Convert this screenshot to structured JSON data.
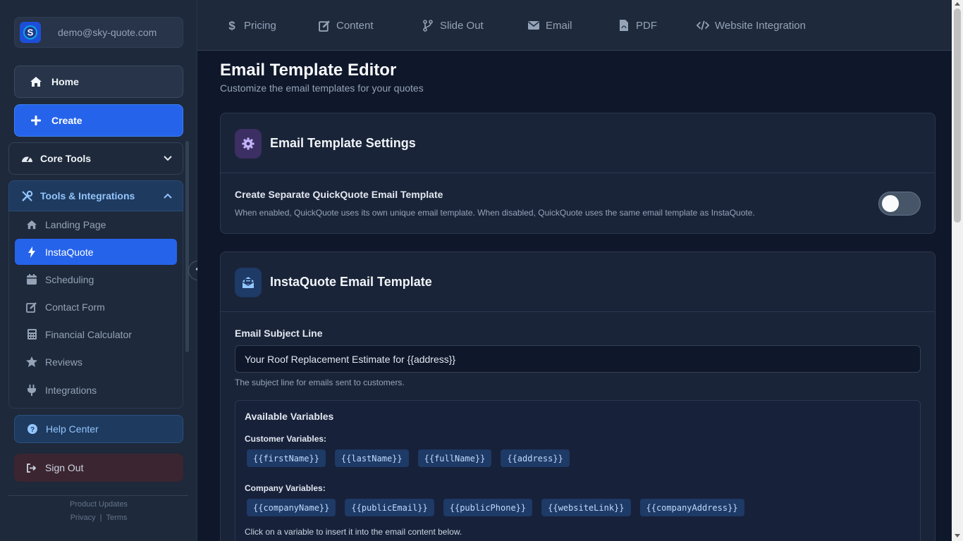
{
  "account": {
    "email": "demo@sky-quote.com"
  },
  "sidebar": {
    "home_label": "Home",
    "create_label": "Create",
    "core_tools_label": "Core Tools",
    "tools_integrations_label": "Tools & Integrations",
    "items": [
      {
        "label": "Landing Page",
        "icon": "house-icon"
      },
      {
        "label": "InstaQuote",
        "icon": "bolt-icon"
      },
      {
        "label": "Scheduling",
        "icon": "calendar-icon"
      },
      {
        "label": "Contact Form",
        "icon": "edit-icon"
      },
      {
        "label": "Financial Calculator",
        "icon": "calculator-icon"
      },
      {
        "label": "Reviews",
        "icon": "star-icon"
      },
      {
        "label": "Integrations",
        "icon": "plug-icon"
      }
    ],
    "active_item": "InstaQuote",
    "help_label": "Help Center",
    "signout_label": "Sign Out",
    "footer": {
      "product_updates": "Product Updates",
      "privacy": "Privacy",
      "separator": "|",
      "terms": "Terms"
    }
  },
  "topnav": {
    "tabs": [
      {
        "label": "Pricing",
        "icon": "dollar-icon"
      },
      {
        "label": "Content",
        "icon": "edit-icon"
      },
      {
        "label": "Slide Out",
        "icon": "branch-icon"
      },
      {
        "label": "Email",
        "icon": "envelope-icon"
      },
      {
        "label": "PDF",
        "icon": "pdf-file-icon"
      },
      {
        "label": "Website Integration",
        "icon": "code-icon"
      }
    ]
  },
  "page": {
    "title": "Email Template Editor",
    "subtitle": "Customize the email templates for your quotes"
  },
  "settings_card": {
    "title": "Email Template Settings",
    "setting_label": "Create Separate QuickQuote Email Template",
    "setting_desc": "When enabled, QuickQuote uses its own unique email template. When disabled, QuickQuote uses the same email template as InstaQuote.",
    "toggle_on": false
  },
  "template_card": {
    "title": "InstaQuote Email Template",
    "subject_label": "Email Subject Line",
    "subject_value": "Your Roof Replacement Estimate for {{address}}",
    "subject_help": "The subject line for emails sent to customers.",
    "variables": {
      "title": "Available Variables",
      "customer_label": "Customer Variables:",
      "customer": [
        "{{firstName}}",
        "{{lastName}}",
        "{{fullName}}",
        "{{address}}"
      ],
      "company_label": "Company Variables:",
      "company": [
        "{{companyName}}",
        "{{publicEmail}}",
        "{{publicPhone}}",
        "{{websiteLink}}",
        "{{companyAddress}}"
      ],
      "note": "Click on a variable to insert it into the email content below."
    }
  },
  "colors": {
    "accent": "#2563eb",
    "background": "#0f172a",
    "panel": "#1e293b"
  }
}
